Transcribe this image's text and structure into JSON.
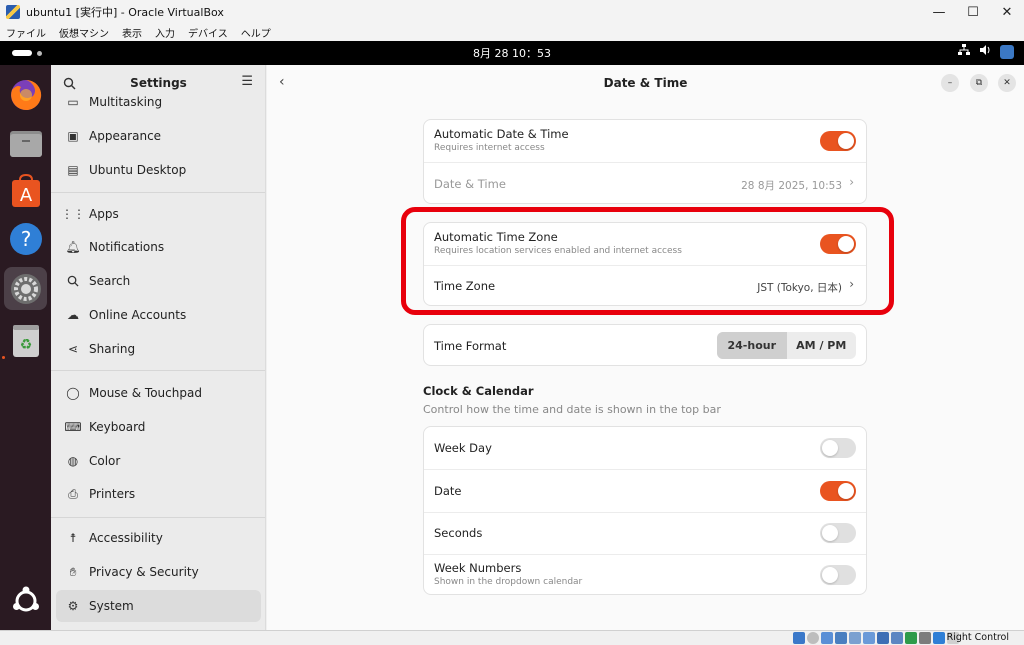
{
  "host_window": {
    "title": "ubuntu1 [実行中] - Oracle VirtualBox",
    "controls": [
      "minimize",
      "maximize",
      "close"
    ],
    "menu": [
      "ファイル",
      "仮想マシン",
      "表示",
      "入力",
      "デバイス",
      "ヘルプ"
    ]
  },
  "topbar": {
    "clock": "8月 28  10：53",
    "tray_icons": [
      "network-icon",
      "volume-icon",
      "virtualbox-guest-icon"
    ]
  },
  "dock": {
    "apps": [
      "firefox",
      "files",
      "app-center",
      "help",
      "settings",
      "trash",
      "show-apps"
    ],
    "active": "settings"
  },
  "sidebar": {
    "title": "Settings",
    "items": [
      {
        "icon": "multitasking-icon",
        "label": "Multitasking"
      },
      {
        "icon": "appearance-icon",
        "label": "Appearance"
      },
      {
        "icon": "ubuntu-desktop-icon",
        "label": "Ubuntu Desktop"
      },
      {
        "icon": "apps-icon",
        "label": "Apps"
      },
      {
        "icon": "bell-icon",
        "label": "Notifications"
      },
      {
        "icon": "search-icon",
        "label": "Search"
      },
      {
        "icon": "cloud-icon",
        "label": "Online Accounts"
      },
      {
        "icon": "share-icon",
        "label": "Sharing"
      },
      {
        "icon": "mouse-icon",
        "label": "Mouse & Touchpad"
      },
      {
        "icon": "keyboard-icon",
        "label": "Keyboard"
      },
      {
        "icon": "color-icon",
        "label": "Color"
      },
      {
        "icon": "printer-icon",
        "label": "Printers"
      },
      {
        "icon": "accessibility-icon",
        "label": "Accessibility"
      },
      {
        "icon": "hand-icon",
        "label": "Privacy & Security"
      },
      {
        "icon": "gear-icon",
        "label": "System"
      }
    ],
    "selected": "System"
  },
  "main": {
    "title": "Date & Time",
    "auto_datetime": {
      "title": "Automatic Date & Time",
      "subtitle": "Requires internet access",
      "enabled": true
    },
    "datetime": {
      "title": "Date & Time",
      "value": "28 8月 2025, 10:53"
    },
    "auto_timezone": {
      "title": "Automatic Time Zone",
      "subtitle": "Requires location services enabled and internet access",
      "enabled": true
    },
    "timezone": {
      "title": "Time Zone",
      "value": "JST (Tokyo, 日本)"
    },
    "time_format": {
      "title": "Time Format",
      "options": [
        "24-hour",
        "AM / PM"
      ],
      "selected": "24-hour"
    },
    "clock_calendar": {
      "title": "Clock & Calendar",
      "subtitle": "Control how the time and date is shown in the top bar",
      "week_day": {
        "title": "Week Day",
        "enabled": false
      },
      "date": {
        "title": "Date",
        "enabled": true
      },
      "seconds": {
        "title": "Seconds",
        "enabled": false
      },
      "week_numbers": {
        "title": "Week Numbers",
        "subtitle": "Shown in the dropdown calendar",
        "enabled": false
      }
    }
  },
  "statusbar": {
    "host_key": "Right Control"
  },
  "colors": {
    "accent": "#e95420",
    "highlight": "#e8000c"
  }
}
